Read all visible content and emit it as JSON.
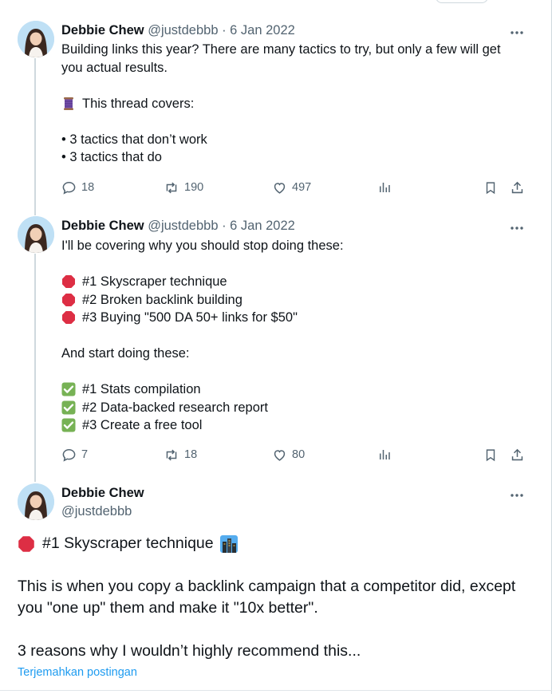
{
  "tweets": [
    {
      "name": "Debbie Chew",
      "meta": "@justdebbb · 6 Jan 2022",
      "lines": [
        {
          "text": "Building links this year? There are many tactics to try, but only a few will get"
        },
        {
          "text": "you actual results."
        },
        {
          "text": ""
        },
        {
          "emoji": "thread-spool-icon",
          "text": "This thread covers:"
        },
        {
          "text": ""
        },
        {
          "text": "• 3 tactics that don’t work"
        },
        {
          "text": "• 3 tactics that do"
        }
      ],
      "stats": {
        "replies": "18",
        "reposts": "190",
        "likes": "497"
      }
    },
    {
      "name": "Debbie Chew",
      "meta": "@justdebbb · 6 Jan 2022",
      "lines": [
        {
          "text": "I'll be covering why you should stop doing these:"
        },
        {
          "text": ""
        },
        {
          "emoji": "stop-sign-icon",
          "text": "#1 Skyscraper technique"
        },
        {
          "emoji": "stop-sign-icon",
          "text": "#2 Broken backlink building"
        },
        {
          "emoji": "stop-sign-icon",
          "text": "#3 Buying \"500 DA 50+ links for $50\""
        },
        {
          "text": ""
        },
        {
          "text": "And start doing these:"
        },
        {
          "text": ""
        },
        {
          "emoji": "check-mark-icon",
          "text": "#1 Stats compilation"
        },
        {
          "emoji": "check-mark-icon",
          "text": "#2 Data-backed research report"
        },
        {
          "emoji": "check-mark-icon",
          "text": "#3 Create a free tool"
        }
      ],
      "stats": {
        "replies": "7",
        "reposts": "18",
        "likes": "80"
      }
    }
  ],
  "focused": {
    "name": "Debbie Chew",
    "handle": "@justdebbb",
    "lines": [
      {
        "emoji": "stop-sign-icon",
        "text": "#1 Skyscraper technique",
        "trailing_emoji": "cityscape-icon"
      },
      {
        "text": ""
      },
      {
        "text": "This is when you copy a backlink campaign that a competitor did, except"
      },
      {
        "text": "you \"one up\" them and make it \"10x better\"."
      },
      {
        "text": ""
      },
      {
        "text": "3 reasons why I wouldn’t highly recommend this..."
      }
    ],
    "translate_label": "Terjemahkan postingan"
  },
  "colors": {
    "accent": "#1d9bf0",
    "secondary_text": "#536471",
    "stop_red": "#dd2e44",
    "check_green": "#77b255"
  }
}
